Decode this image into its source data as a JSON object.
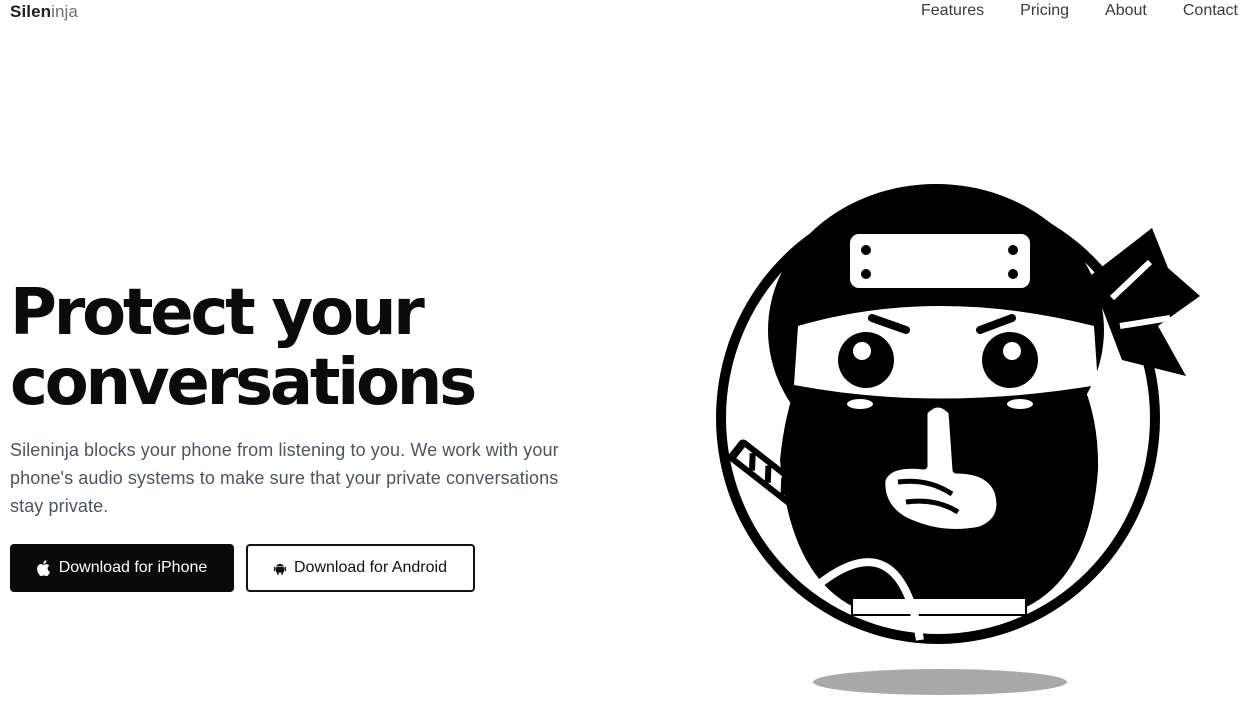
{
  "nav": {
    "brand_primary": "Silen",
    "brand_secondary": "inja",
    "links": [
      "Features",
      "Pricing",
      "About",
      "Contact"
    ]
  },
  "hero": {
    "title_line1": "Protect your",
    "title_line2": "conversations",
    "description": "Sileninja blocks your phone from listening to you. We work with your phone's audio systems to make sure that your private conversations stay private.",
    "buttons": {
      "ios_label": "Download for iPhone",
      "android_label": "Download for Android"
    }
  },
  "icons": {
    "ios": "apple-icon",
    "android": "android-icon",
    "mascot": "ninja-mascot-shh"
  },
  "colors": {
    "text": "#0b0b0b",
    "muted": "#4b5563",
    "brand_muted": "#6b7280",
    "primary_button": "#0a0a0a"
  }
}
